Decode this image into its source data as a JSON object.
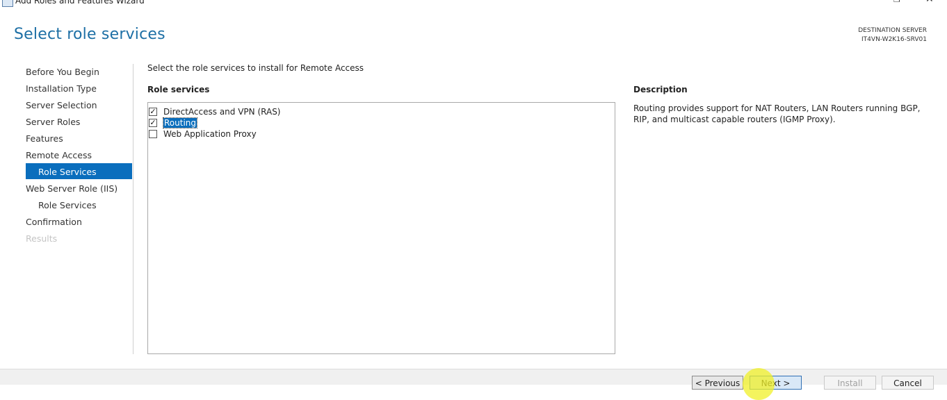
{
  "window": {
    "title": "Add Roles and Features Wizard",
    "restore_icon": "restore-icon",
    "close_icon": "close-icon"
  },
  "page_title": "Select role services",
  "destination": {
    "label": "DESTINATION SERVER",
    "server": "IT4VN-W2K16-SRV01"
  },
  "nav": {
    "items": [
      {
        "label": "Before You Begin"
      },
      {
        "label": "Installation Type"
      },
      {
        "label": "Server Selection"
      },
      {
        "label": "Server Roles"
      },
      {
        "label": "Features"
      },
      {
        "label": "Remote Access"
      },
      {
        "label": "Role Services",
        "active": true
      },
      {
        "label": "Web Server Role (IIS)"
      },
      {
        "label": "Role Services"
      },
      {
        "label": "Confirmation"
      },
      {
        "label": "Results",
        "disabled": true
      }
    ]
  },
  "main": {
    "instruction": "Select the role services to install for Remote Access",
    "role_services_header": "Role services",
    "role_services": [
      {
        "label": "DirectAccess and VPN (RAS)",
        "checked": true
      },
      {
        "label": "Routing",
        "checked": true,
        "selected": true
      },
      {
        "label": "Web Application Proxy",
        "checked": false
      }
    ],
    "description_header": "Description",
    "description": "Routing provides support for NAT Routers, LAN Routers running BGP, RIP, and multicast capable routers (IGMP Proxy)."
  },
  "footer": {
    "previous_label": "< Previous",
    "next_label": "Next >",
    "install_label": "Install",
    "cancel_label": "Cancel"
  },
  "colors": {
    "accent": "#0a6ebd",
    "title": "#1d6fa5",
    "disabled": "#c4c4c4"
  }
}
